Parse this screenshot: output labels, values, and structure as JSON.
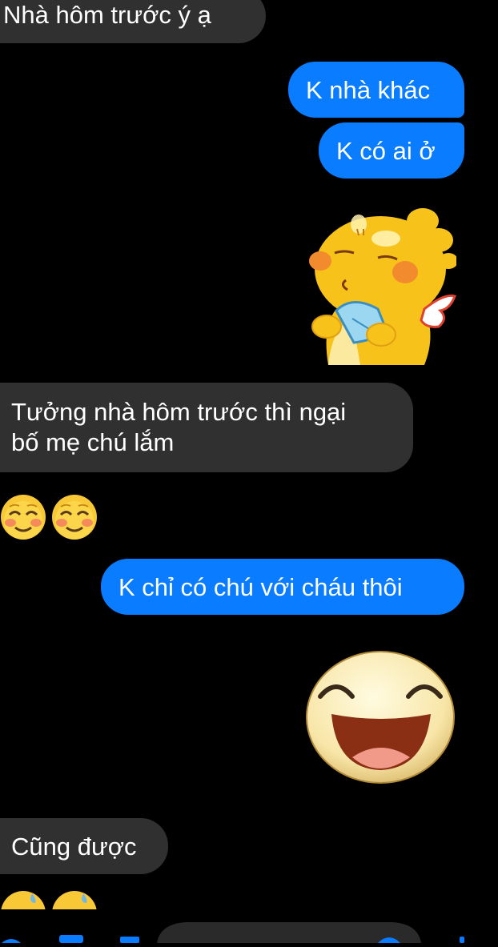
{
  "messages": {
    "m1": "Nhà hôm trước ý ạ",
    "m2": "K nhà khác",
    "m3": "K có ai ở",
    "m4_line1": "Tưởng nhà hôm trước thì ngại",
    "m4_line2": "bố mẹ chú lắm",
    "m5": "K chỉ có chú với cháu thôi",
    "m6": "Cũng được"
  },
  "stickers": {
    "fan_sticker": "yellow-dragon-fanning-sticker",
    "laugh_sticker": "laughing-face-sticker"
  },
  "emojis": {
    "row1": [
      "smiling-face-with-smiling-eyes",
      "smiling-face-with-smiling-eyes"
    ],
    "row2": [
      "grinning-face-with-sweat",
      "grinning-face-with-sweat"
    ]
  },
  "colors": {
    "background": "#000000",
    "incoming_bubble": "#303030",
    "outgoing_bubble": "#0a7cff",
    "text": "#ffffff"
  }
}
